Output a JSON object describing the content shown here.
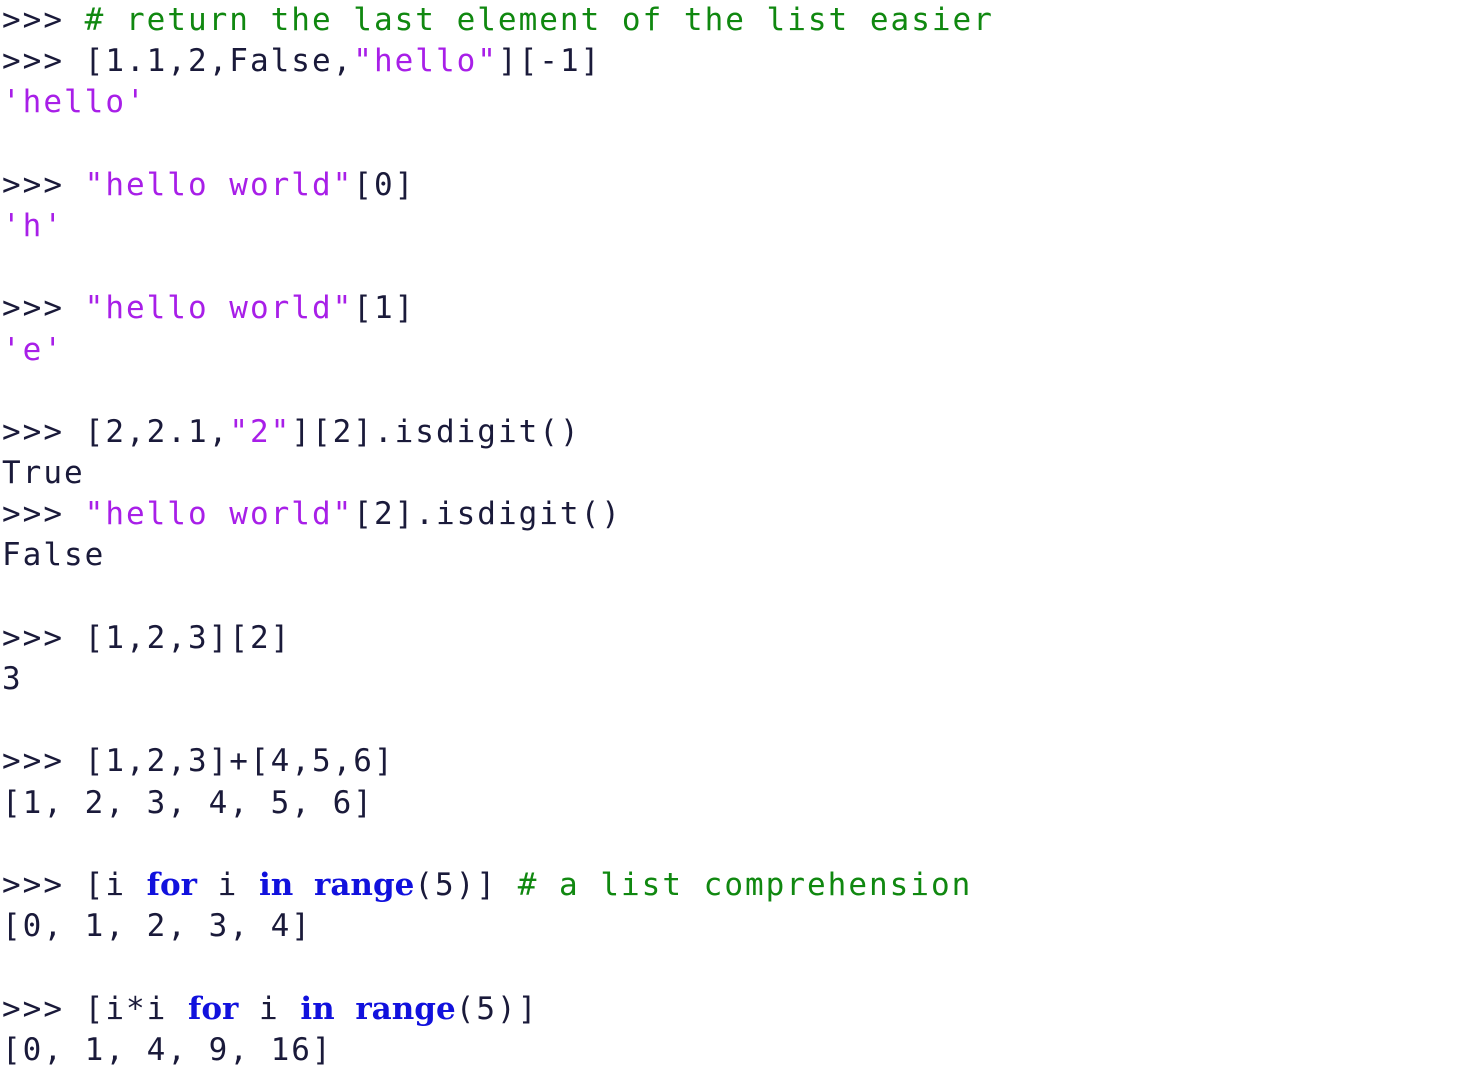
{
  "terminal": {
    "kind": "python-repl-transcript",
    "prompt": ">>> ",
    "colors": {
      "background": "#ffffff",
      "plain": "#1a1a3a",
      "comment": "#108810",
      "string": "#a81fe8",
      "keyword": "#1111dd"
    },
    "lines": [
      {
        "type": "input",
        "text": ">>> # return the last element of the list easier",
        "tokens": [
          {
            "cls": "t-prompt",
            "text": ">>> "
          },
          {
            "cls": "t-comment",
            "text": "# return the last element of the list easier"
          }
        ]
      },
      {
        "type": "input",
        "text": ">>> [1.1,2,False,\"hello\"][-1]",
        "tokens": [
          {
            "cls": "t-prompt",
            "text": ">>> "
          },
          {
            "cls": "t-plain",
            "text": "[1.1,2,False,"
          },
          {
            "cls": "t-string",
            "text": "\"hello\""
          },
          {
            "cls": "t-plain",
            "text": "][-1]"
          }
        ]
      },
      {
        "type": "output",
        "text": "'hello'",
        "tokens": [
          {
            "cls": "t-output-string",
            "text": "'hello'"
          }
        ]
      },
      {
        "type": "blank",
        "text": "",
        "tokens": []
      },
      {
        "type": "input",
        "text": ">>> \"hello world\"[0]",
        "tokens": [
          {
            "cls": "t-prompt",
            "text": ">>> "
          },
          {
            "cls": "t-string",
            "text": "\"hello world\""
          },
          {
            "cls": "t-plain",
            "text": "[0]"
          }
        ]
      },
      {
        "type": "output",
        "text": "'h'",
        "tokens": [
          {
            "cls": "t-output-string",
            "text": "'h'"
          }
        ]
      },
      {
        "type": "blank",
        "text": "",
        "tokens": []
      },
      {
        "type": "input",
        "text": ">>> \"hello world\"[1]",
        "tokens": [
          {
            "cls": "t-prompt",
            "text": ">>> "
          },
          {
            "cls": "t-string",
            "text": "\"hello world\""
          },
          {
            "cls": "t-plain",
            "text": "[1]"
          }
        ]
      },
      {
        "type": "output",
        "text": "'e'",
        "tokens": [
          {
            "cls": "t-output-string",
            "text": "'e'"
          }
        ]
      },
      {
        "type": "blank",
        "text": "",
        "tokens": []
      },
      {
        "type": "input",
        "text": ">>> [2,2.1,\"2\"][2].isdigit()",
        "tokens": [
          {
            "cls": "t-prompt",
            "text": ">>> "
          },
          {
            "cls": "t-plain",
            "text": "[2,2.1,"
          },
          {
            "cls": "t-string",
            "text": "\"2\""
          },
          {
            "cls": "t-plain",
            "text": "][2].isdigit()"
          }
        ]
      },
      {
        "type": "output",
        "text": "True",
        "tokens": [
          {
            "cls": "t-plain",
            "text": "True"
          }
        ]
      },
      {
        "type": "input",
        "text": ">>> \"hello world\"[2].isdigit()",
        "tokens": [
          {
            "cls": "t-prompt",
            "text": ">>> "
          },
          {
            "cls": "t-string",
            "text": "\"hello world\""
          },
          {
            "cls": "t-plain",
            "text": "[2].isdigit()"
          }
        ]
      },
      {
        "type": "output",
        "text": "False",
        "tokens": [
          {
            "cls": "t-plain",
            "text": "False"
          }
        ]
      },
      {
        "type": "blank",
        "text": "",
        "tokens": []
      },
      {
        "type": "input",
        "text": ">>> [1,2,3][2]",
        "tokens": [
          {
            "cls": "t-prompt",
            "text": ">>> "
          },
          {
            "cls": "t-plain",
            "text": "[1,2,3][2]"
          }
        ]
      },
      {
        "type": "output",
        "text": "3",
        "tokens": [
          {
            "cls": "t-plain",
            "text": "3"
          }
        ]
      },
      {
        "type": "blank",
        "text": "",
        "tokens": []
      },
      {
        "type": "input",
        "text": ">>> [1,2,3]+[4,5,6]",
        "tokens": [
          {
            "cls": "t-prompt",
            "text": ">>> "
          },
          {
            "cls": "t-plain",
            "text": "[1,2,3]+[4,5,6]"
          }
        ]
      },
      {
        "type": "output",
        "text": "[1, 2, 3, 4, 5, 6]",
        "tokens": [
          {
            "cls": "t-plain",
            "text": "[1, 2, 3, 4, 5, 6]"
          }
        ]
      },
      {
        "type": "blank",
        "text": "",
        "tokens": []
      },
      {
        "type": "input",
        "text": ">>> [i for i in range(5)] # a list comprehension",
        "tokens": [
          {
            "cls": "t-prompt",
            "text": ">>> "
          },
          {
            "cls": "t-plain",
            "text": "[i "
          },
          {
            "cls": "t-keyword",
            "text": "for"
          },
          {
            "cls": "t-plain",
            "text": " i "
          },
          {
            "cls": "t-keyword",
            "text": "in"
          },
          {
            "cls": "t-plain",
            "text": " "
          },
          {
            "cls": "t-builtin",
            "text": "range"
          },
          {
            "cls": "t-plain",
            "text": "(5)] "
          },
          {
            "cls": "t-comment",
            "text": "# a list comprehension"
          }
        ]
      },
      {
        "type": "output",
        "text": "[0, 1, 2, 3, 4]",
        "tokens": [
          {
            "cls": "t-plain",
            "text": "[0, 1, 2, 3, 4]"
          }
        ]
      },
      {
        "type": "blank",
        "text": "",
        "tokens": []
      },
      {
        "type": "input",
        "text": ">>> [i*i for i in range(5)]",
        "tokens": [
          {
            "cls": "t-prompt",
            "text": ">>> "
          },
          {
            "cls": "t-plain",
            "text": "[i*i "
          },
          {
            "cls": "t-keyword",
            "text": "for"
          },
          {
            "cls": "t-plain",
            "text": " i "
          },
          {
            "cls": "t-keyword",
            "text": "in"
          },
          {
            "cls": "t-plain",
            "text": " "
          },
          {
            "cls": "t-builtin",
            "text": "range"
          },
          {
            "cls": "t-plain",
            "text": "(5)]"
          }
        ]
      },
      {
        "type": "output",
        "text": "[0, 1, 4, 9, 16]",
        "tokens": [
          {
            "cls": "t-plain",
            "text": "[0, 1, 4, 9, 16]"
          }
        ]
      }
    ]
  }
}
